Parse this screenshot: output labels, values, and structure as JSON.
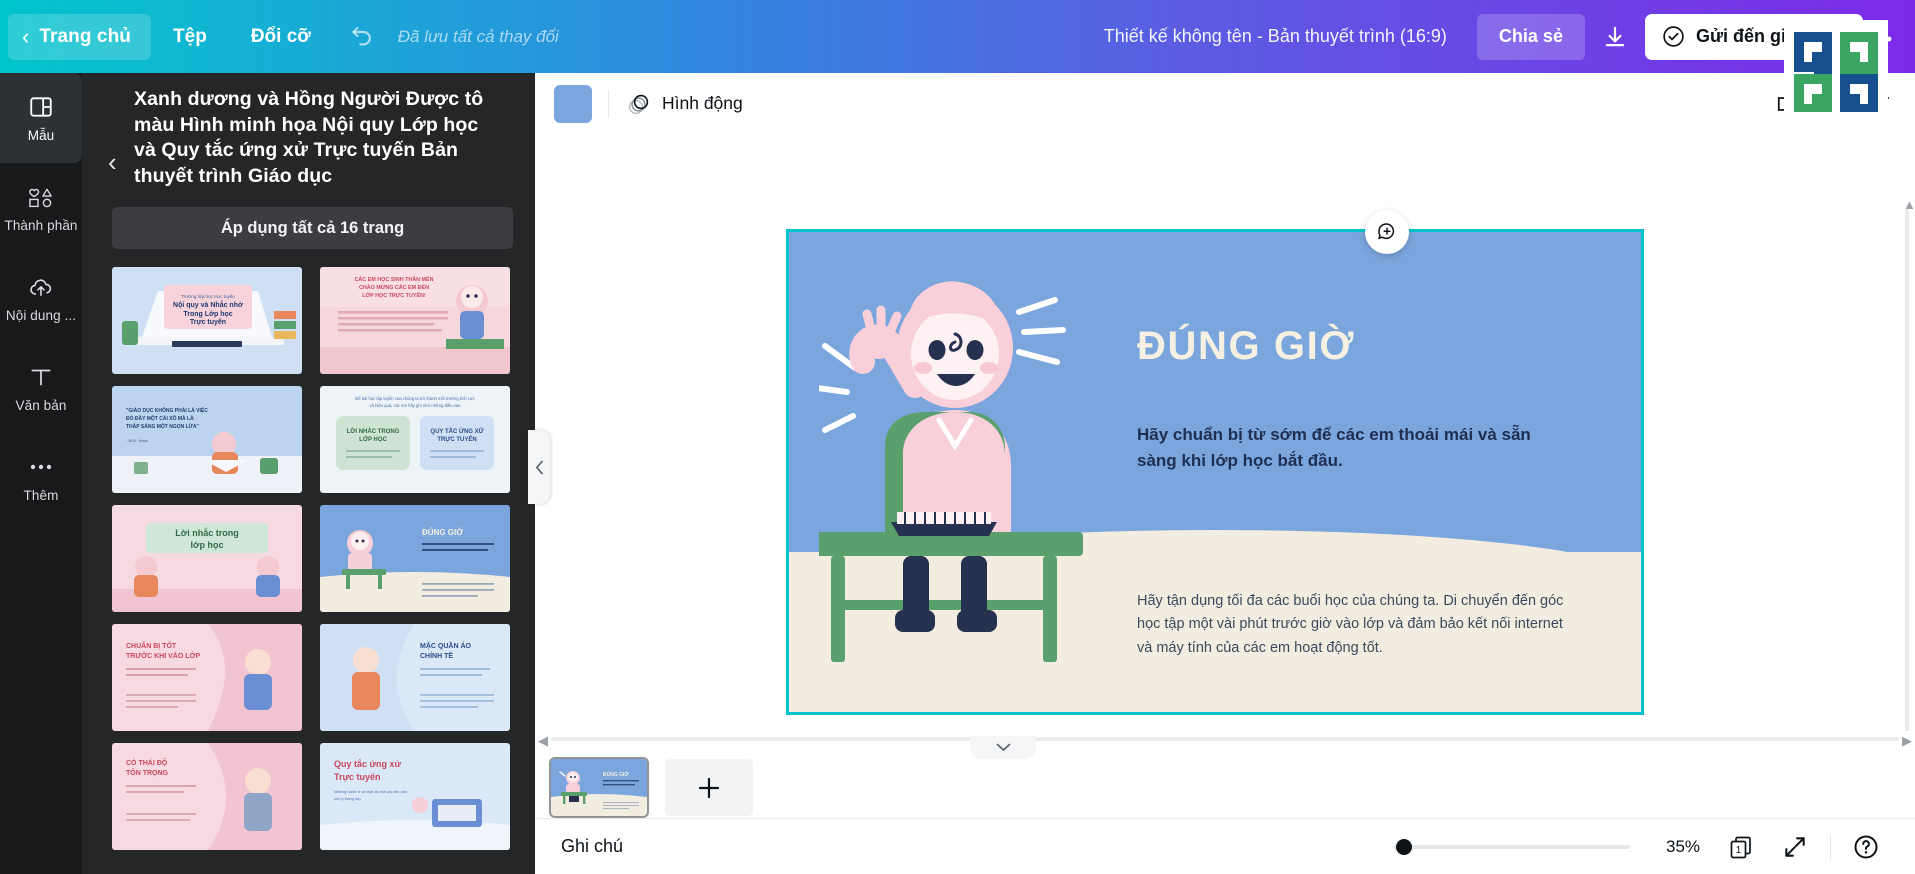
{
  "topbar": {
    "home_label": "Trang chủ",
    "back_icon": "chevron-left-icon",
    "menu_items": [
      "Tệp",
      "Đổi cỡ"
    ],
    "undo_icon": "undo-icon",
    "saved_status": "Đã lưu tất cả thay đổi",
    "doc_title": "Thiết kế không tên - Bản thuyết trình (16:9)",
    "share_label": "Chia sẻ",
    "download_icon": "download-icon",
    "send_label": "Gửi đến giáo",
    "send_icon": "check-circle-icon",
    "kebab_icon": "more-horizontal-icon"
  },
  "rail": {
    "items": [
      {
        "label": "Mẫu",
        "icon": "template-icon",
        "active": true
      },
      {
        "label": "Thành phần",
        "icon": "elements-icon",
        "active": false
      },
      {
        "label": "Nội dung ...",
        "icon": "upload-cloud-icon",
        "active": false
      },
      {
        "label": "Văn bản",
        "icon": "text-icon",
        "active": false
      },
      {
        "label": "Thêm",
        "icon": "more-dots-icon",
        "active": false
      }
    ]
  },
  "panel": {
    "back_icon": "chevron-left-icon",
    "title": "Xanh dương và Hồng Người Được tô màu Hình minh họa Nội quy Lớp học và Quy tắc ứng xử Trực tuyến Bản thuyết trình Giáo dục",
    "apply_all_label": "Áp dụng tất cả 16 trang",
    "collapse_icon": "chevron-left-icon",
    "thumbnails": [
      {
        "id": "t1",
        "heading": "Nội quy và Nhắc nhở Trong Lớp học Trực tuyến",
        "bg": "#cfe0f5"
      },
      {
        "id": "t2",
        "heading": "CÁC EM HỌC SINH THÂN MẾN CHÀO MỪNG CÁC EM ĐẾN LỚP HỌC TRỰC TUYẾN!",
        "bg": "#f6d7dc"
      },
      {
        "id": "t3",
        "heading": "\"GIÁO DỤC KHÔNG PHẢI LÀ VIỆC ĐỔ ĐẦY MỘT CÁI XÔ MÀ LÀ THẮP SÁNG MỘT NGỌN LỬA\"",
        "bg": "#bcd4ef"
      },
      {
        "id": "t4",
        "heading": "LỜI NHẮC TRONG LỚP HỌC / QUY TẮC ỨNG XỬ TRỰC TUYẾN",
        "bg": "#eef3f8"
      },
      {
        "id": "t5",
        "heading": "Lời nhắc trong lớp học",
        "bg": "#f7d9e2"
      },
      {
        "id": "t6",
        "heading": "ĐÚNG GIỜ",
        "bg": "#7aa5dd"
      },
      {
        "id": "t7",
        "heading": "CHUẨN BỊ TỐT TRƯỚC KHI VÀO LỚP",
        "bg": "#f7d9e2"
      },
      {
        "id": "t8",
        "heading": "MẶC QUẦN ÁO CHỈNH TỀ",
        "bg": "#dbe8f7"
      },
      {
        "id": "t9",
        "heading": "CÓ THÁI ĐỘ TÔN TRỌNG",
        "bg": "#f7d9e2"
      },
      {
        "id": "t10",
        "heading": "Quy tắc ứng xử Trực tuyến",
        "bg": "#dbe8f7"
      }
    ]
  },
  "context_bar": {
    "swatch_color": "#7aa5dd",
    "swatch_name": "color-swatch",
    "animate_label": "Hình động",
    "animate_icon": "animate-icon",
    "position_icon": "position-icon",
    "copy_icon": "duplicate-icon",
    "delete_icon": "trash-icon"
  },
  "slide": {
    "title": "ĐÚNG GIỜ",
    "subtitle": "Hãy chuẩn bị từ sớm để các em thoải mái và sẵn sàng khi lớp học bắt đầu.",
    "body": "Hãy tận dụng tối đa các buổi học của chúng ta. Di chuyển đến góc học tập một vài phút trước giờ vào lớp và đảm bảo kết nối internet và máy tính của các em hoạt động tốt.",
    "bg_color": "#7aa5dd",
    "floor_color": "#f3ece0",
    "title_color": "#f5f0e1",
    "selection_color": "#00c4cc",
    "comment_icon": "comment-add-icon"
  },
  "pages": {
    "collapse_icon": "chevron-down-icon",
    "page_number": "1",
    "add_icon": "plus-icon"
  },
  "bottom": {
    "notes_label": "Ghi chú",
    "zoom_percent": "35%",
    "page_count_icon": "pages-icon",
    "page_count": "1",
    "fullscreen_icon": "expand-icon",
    "help_icon": "help-icon"
  }
}
